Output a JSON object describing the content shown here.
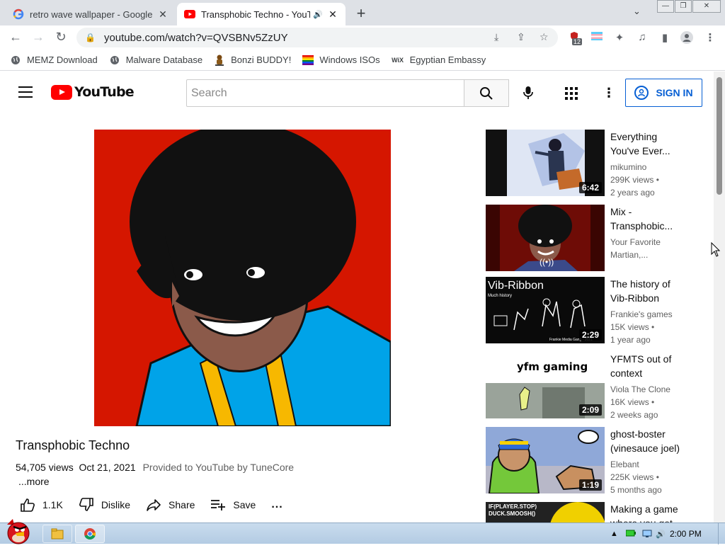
{
  "browser": {
    "tabs": [
      {
        "title": "retro wave wallpaper - Google",
        "icon": "google-icon",
        "active": false
      },
      {
        "title": "Transphobic Techno - YouT",
        "icon": "youtube-icon",
        "active": true,
        "audio": true
      }
    ],
    "url": "youtube.com/watch?v=QVSBNv5ZzUY",
    "extension_badge": "12",
    "bookmarks": [
      {
        "label": "MEMZ Download",
        "icon": "globe-icon"
      },
      {
        "label": "Malware Database",
        "icon": "globe-icon"
      },
      {
        "label": "Bonzi BUDDY!",
        "icon": "bonzi-icon"
      },
      {
        "label": "Windows ISOs",
        "icon": "rainbow-icon"
      },
      {
        "label": "Egyptian Embassy",
        "icon": "wix-icon"
      }
    ]
  },
  "youtube": {
    "logo_text": "YouTube",
    "search_placeholder": "Search",
    "signin_label": "SIGN IN",
    "video": {
      "title": "Transphobic Techno",
      "views": "54,705 views",
      "date": "Oct 21, 2021",
      "provider": "Provided to YouTube by TuneCore",
      "more": "...more",
      "likes": "1.1K",
      "dislike_label": "Dislike",
      "share_label": "Share",
      "save_label": "Save",
      "more_actions": "..."
    },
    "recommendations": [
      {
        "title": "Everything You've Ever...",
        "channel": "mikumino",
        "views": "299K views",
        "age": "2 years ago",
        "duration": "6:42"
      },
      {
        "title": "Mix - Transphobic...",
        "channel": "Your Favorite",
        "views": "Martian,...",
        "age": "",
        "duration": ""
      },
      {
        "title": "The history of Vib-Ribbon",
        "channel": "Frankie's games",
        "views": "15K views",
        "age": "1 year ago",
        "duration": "2:29",
        "thumb_title": "Vib-Ribbon",
        "thumb_sub": "Much history",
        "thumb_footer": "Frankie Media Gang - 2021"
      },
      {
        "title": "YFMTS out of context",
        "channel": "Viola The Clone",
        "views": "16K views",
        "age": "2 weeks ago",
        "duration": "2:09",
        "thumb_title": "yfm gaming"
      },
      {
        "title": "ghost-boster (vinesauce joel)",
        "channel": "Elebant",
        "views": "225K views",
        "age": "5 months ago",
        "duration": "1:19"
      },
      {
        "title": "Making a game where you get",
        "channel": "",
        "views": "",
        "age": "",
        "duration": "",
        "thumb_title": "IF(PLAYER.STOP) DUCK.SMOOSH()"
      }
    ]
  },
  "taskbar": {
    "clock": "2:00 PM"
  }
}
